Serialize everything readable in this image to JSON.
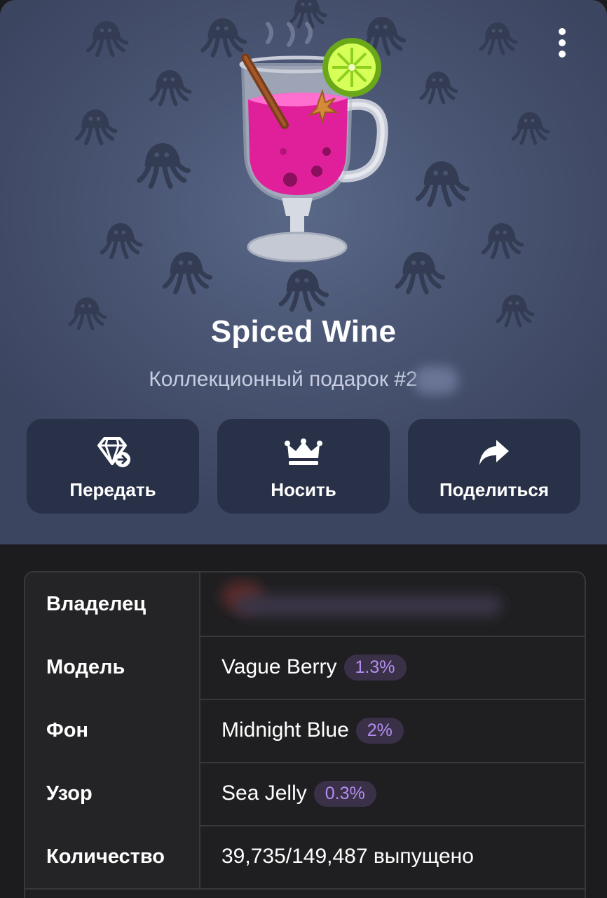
{
  "gift": {
    "title": "Spiced Wine",
    "subtitle": "Коллекционный подарок #2"
  },
  "actions": [
    {
      "label": "Передать",
      "icon": "gem-transfer-icon"
    },
    {
      "label": "Носить",
      "icon": "crown-icon"
    },
    {
      "label": "Поделиться",
      "icon": "share-arrow-icon"
    }
  ],
  "details": {
    "owner": {
      "key": "Владелец",
      "value": ""
    },
    "model": {
      "key": "Модель",
      "value": "Vague Berry",
      "rarity": "1.3%"
    },
    "backdrop": {
      "key": "Фон",
      "value": "Midnight Blue",
      "rarity": "2%"
    },
    "pattern": {
      "key": "Узор",
      "value": "Sea Jelly",
      "rarity": "0.3%"
    },
    "quantity": {
      "key": "Количество",
      "value": "39,735/149,487 выпущено"
    }
  },
  "colors": {
    "header_bg": "#4a5674",
    "button_bg": "#283147",
    "badge_text": "#b48df0",
    "badge_bg": "#3a3148",
    "page_bg": "#1c1c1e"
  }
}
